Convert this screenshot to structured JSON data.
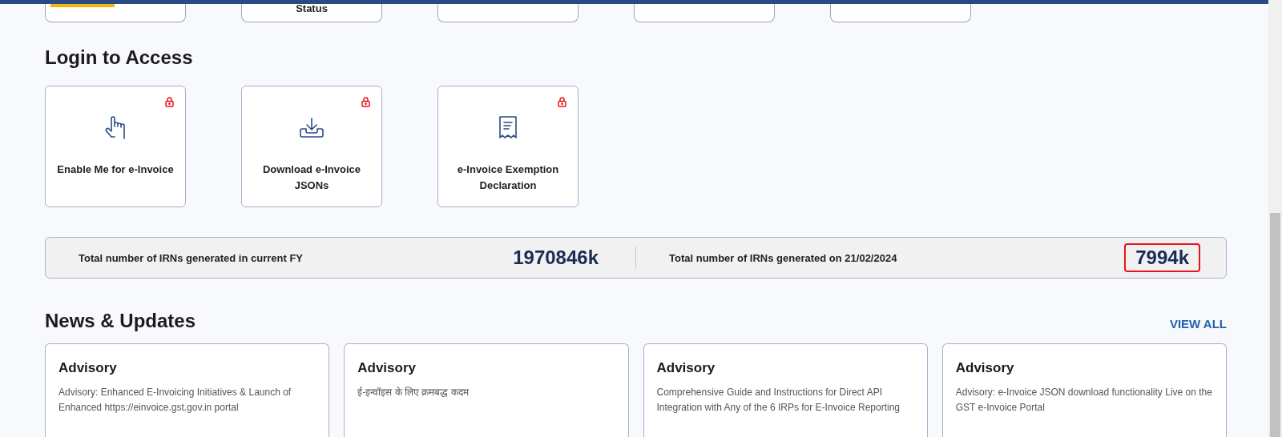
{
  "top_cards": [
    {
      "selected": true
    },
    {
      "label": "Status",
      "selected": false
    },
    {
      "selected": false
    },
    {
      "selected": false
    },
    {
      "selected": false
    }
  ],
  "login_section": {
    "title": "Login to Access",
    "cards": [
      {
        "kind": "pointer",
        "label": "Enable Me for e-Invoice",
        "locked": true
      },
      {
        "kind": "download",
        "label": "Download e-Invoice JSONs",
        "locked": true
      },
      {
        "kind": "receipt",
        "label": "e-Invoice Exemption Declaration",
        "locked": true
      }
    ]
  },
  "stats": [
    {
      "label": "Total number of IRNs generated in current FY",
      "value": "1970846k",
      "highlighted": false
    },
    {
      "label": "Total number of IRNs generated on 21/02/2024",
      "value": "7994k",
      "highlighted": true
    }
  ],
  "news": {
    "title": "News & Updates",
    "view_all": "VIEW ALL",
    "items": [
      {
        "title": "Advisory",
        "text": "Advisory: Enhanced E-Invoicing Initiatives & Launch of Enhanced https://einvoice.gst.gov.in portal"
      },
      {
        "title": "Advisory",
        "text": "ई-इन्वॉइस के लिए क्रमबद्ध कदम"
      },
      {
        "title": "Advisory",
        "text": "Comprehensive Guide and Instructions for Direct API Integration with Any of the 6 IRPs for E-Invoice Reporting"
      },
      {
        "title": "Advisory",
        "text": "Advisory: e-Invoice JSON download functionality Live on the GST e-Invoice Portal"
      }
    ]
  }
}
